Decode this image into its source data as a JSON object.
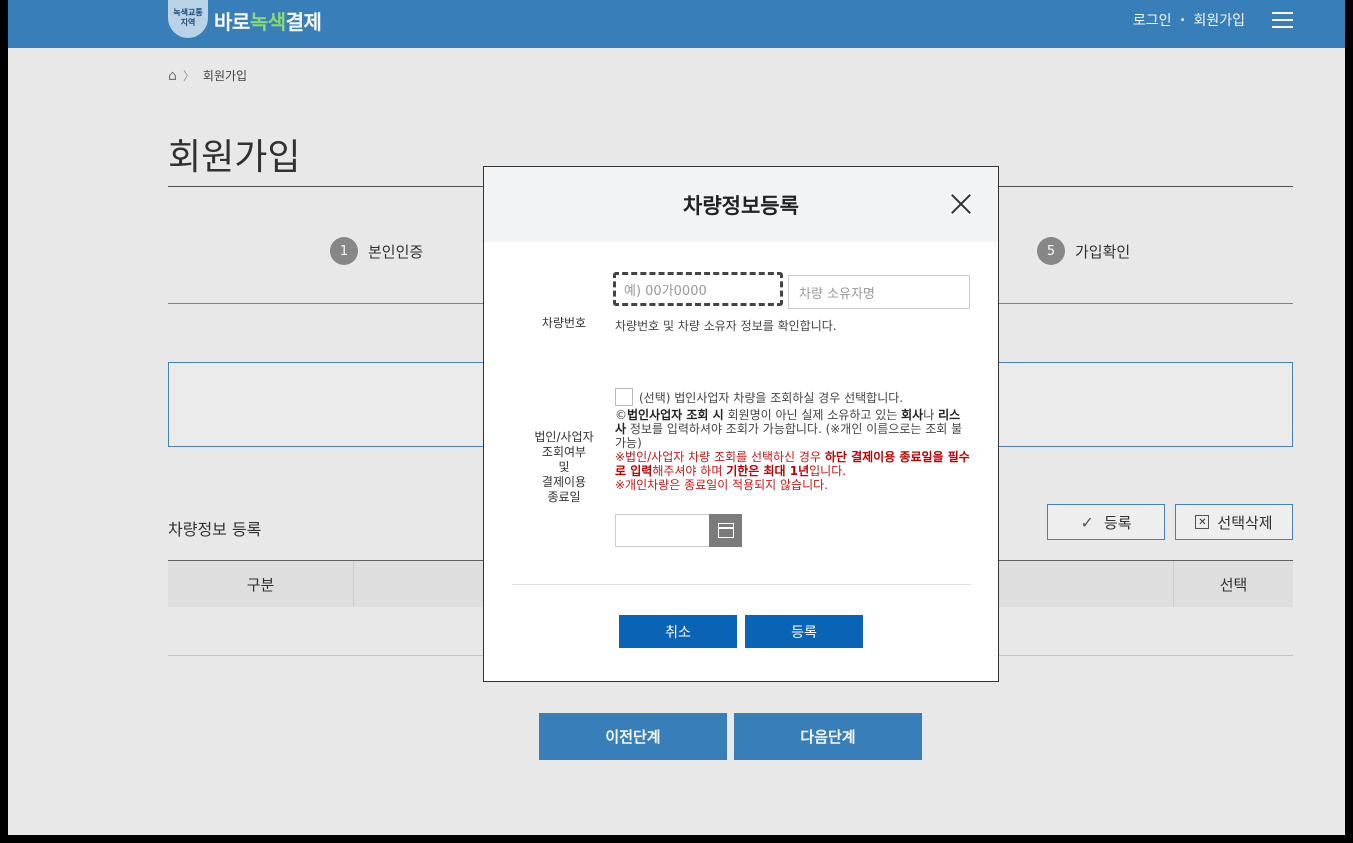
{
  "header": {
    "logo_badge_line1": "녹색교통",
    "logo_badge_line2": "지역",
    "logo_text_a": "바로",
    "logo_text_b": "녹색",
    "logo_text_c": "결제",
    "login_link": "로그인",
    "signup_link": "회원가입",
    "separator": "•"
  },
  "breadcrumb": {
    "home_icon": "⌂",
    "separator": "〉",
    "current": "회원가입"
  },
  "page": {
    "title": "회원가입"
  },
  "steps": [
    {
      "num": "1",
      "label": "본인인증"
    },
    {
      "num": "5",
      "label": "가입확인"
    }
  ],
  "vehicle_section": {
    "title": "차량정보 등록",
    "register_button": "등록",
    "delete_button": "선택삭제",
    "columns": [
      "구분",
      "",
      "선택"
    ]
  },
  "nav_buttons": {
    "prev": "이전단계",
    "next": "다음단계"
  },
  "modal": {
    "title": "차량정보등록",
    "plate_label": "차량번호",
    "plate_placeholder": "예) 00가0000",
    "owner_placeholder": "차량 소유자명",
    "plate_hint": "차량번호 및 차량 소유자 정보를 확인합니다.",
    "corp_label_1": "법인/사업자",
    "corp_label_2": "조회여부",
    "corp_label_3": "및",
    "corp_label_4": "결제이용",
    "corp_label_5": "종료일",
    "corp_checkbox_label": "(선택) 법인사업자 차량을 조회하실 경우 선택합니다.",
    "notice_1a": "©",
    "notice_1b": "법인사업자 조회 시",
    "notice_1c": " 회원명이 아닌 실제 소유하고 있는 ",
    "notice_1d": "회사",
    "notice_1e": "나 ",
    "notice_1f": "리스사",
    "notice_1g": " 정보를 입력하셔야 조회가 가능합니다. (※개인 이름으로는 조회 불가능)",
    "notice_2a": "※법인/사업자 차량 조회를 선택하신 경우 ",
    "notice_2b": "하단 결제이용 종료일을 필수로 입력",
    "notice_2c": "해주셔야 하며 ",
    "notice_2d": "기한은 최대 1년",
    "notice_2e": "입니다.",
    "notice_3": "※개인차량은 종료일이 적용되지 않습니다.",
    "cancel_button": "취소",
    "submit_button": "등록"
  },
  "colors": {
    "header_bg": "#3a83bf",
    "primary_button": "#0b63b6",
    "notice_red": "#d01414"
  }
}
